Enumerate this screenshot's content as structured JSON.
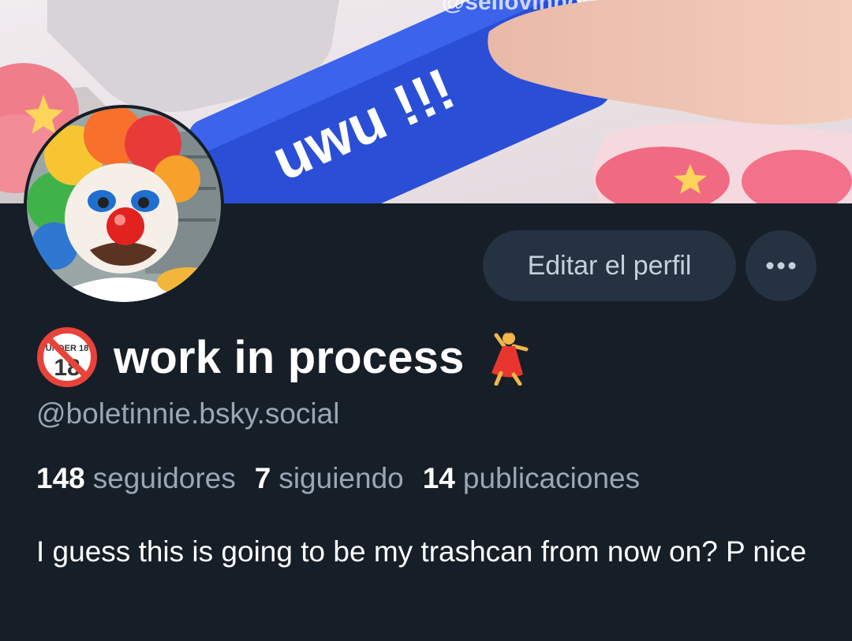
{
  "banner": {
    "watermark": "@seiiovinnoes",
    "key_text": "uwu !!!"
  },
  "profile": {
    "display_name": "work in process",
    "handle": "@boletinnie.bsky.social",
    "badge_text": "UNDER 18",
    "stats": [
      {
        "value": "148",
        "label": "seguidores"
      },
      {
        "value": "7",
        "label": "siguiendo"
      },
      {
        "value": "14",
        "label": "publicaciones"
      }
    ],
    "bio": "I guess this is going to be my trashcan from now on? P nice"
  },
  "actions": {
    "edit_label": "Editar el perfil",
    "more_icon": "ellipsis-icon"
  },
  "colors": {
    "background": "#161e27",
    "button_bg": "#253241",
    "muted_text": "#9aa6b5",
    "key_blue": "#2a4fd6"
  }
}
